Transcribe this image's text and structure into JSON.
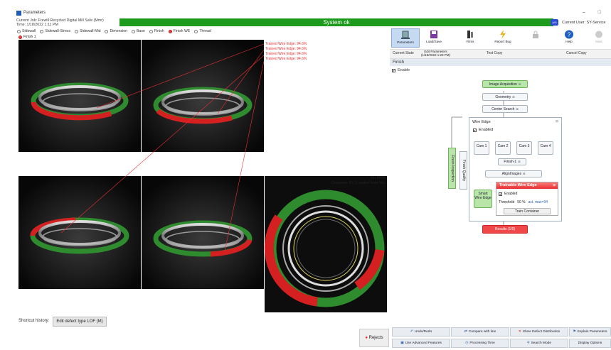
{
  "window": {
    "title": "Parameters"
  },
  "info": {
    "line1": "Current Job: Frewill Recycled Digital Mill Safe (Mmr)",
    "line2": "Time: 1/18/2022 1:11 PM"
  },
  "status": {
    "text": "System ok"
  },
  "user": {
    "avatar": "A/S",
    "label": "Current User: SY-Service"
  },
  "view_radios": [
    {
      "label": "Sidewall",
      "selected": false
    },
    {
      "label": "Sidewall-Stress",
      "selected": false
    },
    {
      "label": "Sidewall-Mid",
      "selected": false
    },
    {
      "label": "Dimension",
      "selected": false
    },
    {
      "label": "Base",
      "selected": false
    },
    {
      "label": "Finish",
      "selected": false
    },
    {
      "label": "Finish WE",
      "selected": true
    },
    {
      "label": "Thread",
      "selected": false
    }
  ],
  "finish_radio": {
    "label": "Finish 1"
  },
  "overlay": {
    "trained_labels": [
      "Trained Wire Edge: 94.6%",
      "Trained Wire Edge: 94.6%",
      "Trained Wire Edge: 94.6%",
      "Trained Wire Edge: 94.6%"
    ],
    "nompr_line1": "No MPR",
    "nompr_line2": "Container ID: (Loaded from file)"
  },
  "shortcut": {
    "label": "Shortcut history:",
    "button": "Edit defect type LOF (M)"
  },
  "rejects": {
    "label": "Rejects"
  },
  "toolbar": [
    {
      "label": "Parameters",
      "icon": "parameters-icon",
      "selected": true,
      "disabled": false
    },
    {
      "label": "Load/Save",
      "icon": "save-icon",
      "selected": false,
      "disabled": false
    },
    {
      "label": "Films",
      "icon": "films-icon",
      "selected": false,
      "disabled": false
    },
    {
      "label": "Report Bug",
      "icon": "bug-icon",
      "selected": false,
      "disabled": false
    },
    {
      "label": "",
      "icon": "lock-icon",
      "selected": false,
      "disabled": true
    },
    {
      "label": "Help",
      "icon": "help-icon",
      "selected": false,
      "disabled": false
    },
    {
      "label": "Next",
      "icon": "next-icon",
      "selected": false,
      "disabled": true
    }
  ],
  "tabs": {
    "current_state": "Current State",
    "edit_params_1": "Edit Parameters",
    "edit_params_2": "(1/18/2022 1:23 PM)",
    "test_copy": "Test Copy",
    "cancel_copy": "Cancel Copy"
  },
  "section": {
    "title": "Finish",
    "enable_label": "Enable"
  },
  "flow": {
    "image_acquisition": "Image Acquisition",
    "geometry": "Geometry",
    "center_search": "Center Search",
    "wire_edge_title": "Wire Edge",
    "wire_edge_enabled": "Enabled",
    "cams": [
      "Cam 1",
      "Cam 2",
      "Cam 3",
      "Cam 4"
    ],
    "finish1": "Finish-1",
    "align_images": "AlignImages",
    "smart_wire_edge": "Smart Wire Edge",
    "finish_inspection": "Finish Inspection",
    "finish_quality": "Finish Quality",
    "results": "Results (1/0)",
    "trainable": {
      "title": "Trainable Wire Edge",
      "enabled": "Enabled",
      "threshold_label": "Threshold",
      "threshold_value": "50 %",
      "threshold_extra": "act. max=94",
      "train_button": "Train Container"
    }
  },
  "bottom_buttons": {
    "undo_redo": "Undo/Redo",
    "compare": "Compare with line",
    "show_defect": "Show Defect Distribution",
    "explain": "Explain Parameters",
    "advanced": "Use Advanced Features",
    "processing": "Processing Time",
    "search": "Search Mode",
    "display": "Display Options"
  },
  "colors": {
    "status_green": "#1c9a1c",
    "ring_green": "#2e8b2e",
    "ring_red": "#d42020",
    "accent_blue": "#2a5fb0"
  }
}
